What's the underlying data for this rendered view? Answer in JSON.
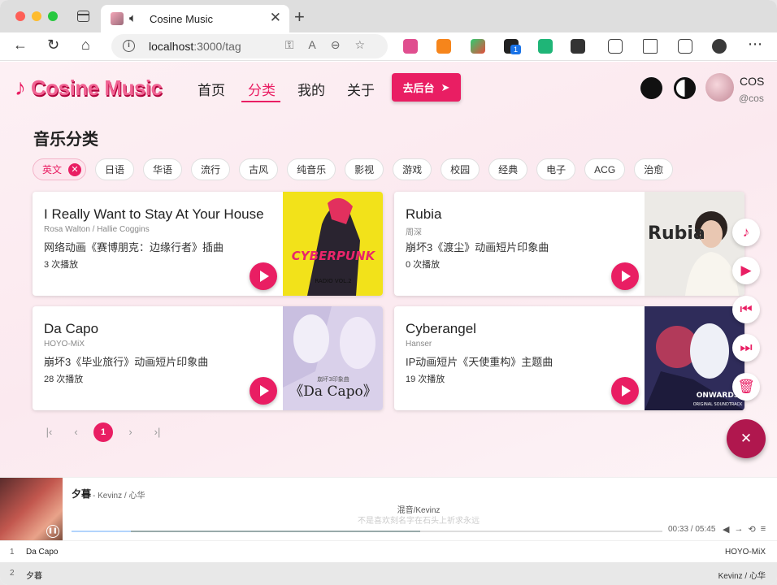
{
  "browser": {
    "tab_title": "Cosine Music",
    "url_host": "localhost",
    "url_path": ":3000/tag"
  },
  "header": {
    "logo": "Cosine Music",
    "nav": [
      "首页",
      "分类",
      "我的",
      "关于"
    ],
    "active_nav": "分类",
    "admin_button": "去后台",
    "user_name": "COS",
    "user_handle": "@cos"
  },
  "section_title": "音乐分类",
  "tags": [
    "英文",
    "日语",
    "华语",
    "流行",
    "古风",
    "纯音乐",
    "影视",
    "游戏",
    "校园",
    "经典",
    "电子",
    "ACG",
    "治愈"
  ],
  "active_tag": "英文",
  "songs": [
    {
      "title": "I Really Want to Stay At Your House",
      "artist": "Rosa Walton / Hallie Coggins",
      "desc": "网络动画《赛博朋克：边缘行者》插曲",
      "plays": "3 次播放",
      "cover_text": "CYBERPUNK",
      "cover_sub": "RADIO VOL.2"
    },
    {
      "title": "Rubia",
      "artist": "周深",
      "desc": "崩坏3《渡尘》动画短片印象曲",
      "plays": "0 次播放",
      "cover_text": "Rubia",
      "cover_sub": ""
    },
    {
      "title": "Da Capo",
      "artist": "HOYO-MiX",
      "desc": "崩坏3《毕业旅行》动画短片印象曲",
      "plays": "28 次播放",
      "cover_text": "《Da Capo》",
      "cover_sub": "崩坏3印象曲"
    },
    {
      "title": "Cyberangel",
      "artist": "Hanser",
      "desc": "IP动画短片《天使重构》主题曲",
      "plays": "19 次播放",
      "cover_text": "ONWARDS",
      "cover_sub": "ORIGINAL SOUNDTRACK"
    }
  ],
  "pagination": {
    "current": "1"
  },
  "player": {
    "title": "夕暮",
    "artist": "- Kevinz / 心华",
    "lyric_line_1": "混音/Kevinz",
    "lyric_line_2": "不是喜欢刻名字在石头上祈求永远",
    "time": "00:33 / 05:45",
    "progress_played": 0.1,
    "progress_loaded": 0.59
  },
  "playlist": [
    {
      "num": "1",
      "title": "Da Capo",
      "artist": "HOYO-MiX"
    },
    {
      "num": "2",
      "title": "夕暮",
      "artist": "Kevinz / 心华"
    }
  ],
  "colors": {
    "accent": "#e91e63",
    "page_bg": "#fbe9ef"
  }
}
